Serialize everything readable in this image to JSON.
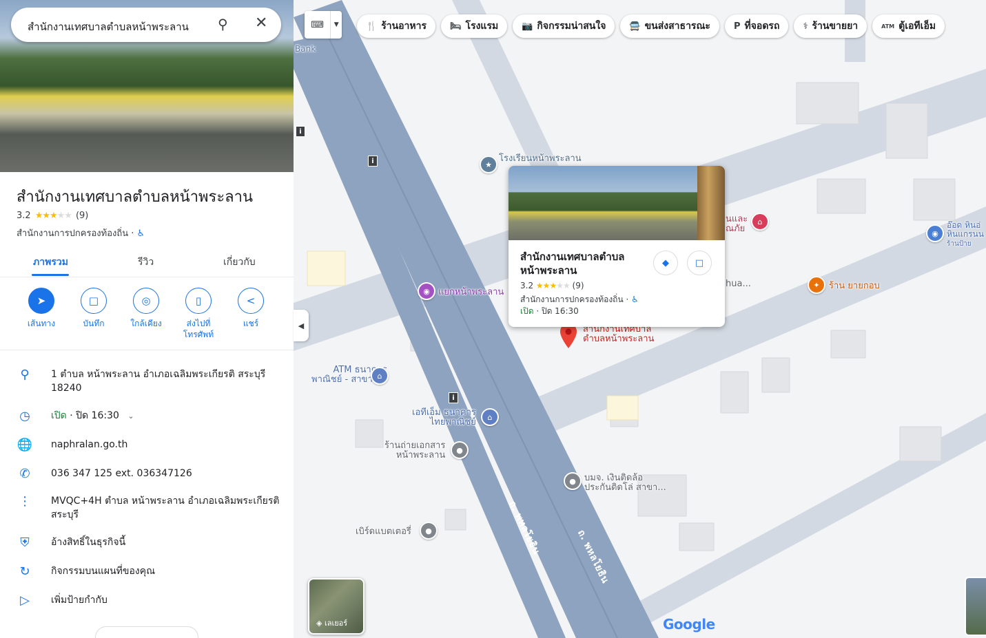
{
  "search": {
    "query": "สำนักงานเทศบาลตำบลหน้าพระลาน"
  },
  "place": {
    "name": "สำนักงานเทศบาลตำบลหน้าพระลาน",
    "rating": "3.2",
    "reviews": "(9)",
    "category": "สำนักงานการปกครองท้องถิ่น ·",
    "accessible_icon": "♿"
  },
  "tabs": [
    {
      "label": "ภาพรวม"
    },
    {
      "label": "รีวิว"
    },
    {
      "label": "เกี่ยวกับ"
    }
  ],
  "actions": [
    {
      "label": "เส้นทาง",
      "icon": "directions-icon"
    },
    {
      "label": "บันทึก",
      "icon": "bookmark-icon"
    },
    {
      "label": "ใกล้เคียง",
      "icon": "nearby-icon"
    },
    {
      "label": "ส่งไปที่",
      "label2": "โทรศัพท์",
      "icon": "send-to-phone-icon"
    },
    {
      "label": "แชร์",
      "icon": "share-icon"
    }
  ],
  "info": {
    "address": "1 ตำบล หน้าพระลาน อำเภอเฉลิมพระเกียรติ สระบุรี 18240",
    "hours_open": "เปิด",
    "hours_close": " · ปิด 16:30",
    "website": "naphralan.go.th",
    "phone": "036 347 125 ext. 036347126",
    "plus_code": "MVQC+4H ตำบล หน้าพระลาน อำเภอเฉลิมพระเกียรติ สระบุรี",
    "claim": "อ้างสิทธิ์ในธุรกิจนี้",
    "activity": "กิจกรรมบนแผนที่ของคุณ",
    "label": "เพิ่มป้ายกำกับ"
  },
  "chips": [
    {
      "label": "ร้านอาหาร",
      "icon": "🍴"
    },
    {
      "label": "โรงแรม",
      "icon": "🛏"
    },
    {
      "label": "กิจกรรมน่าสนใจ",
      "icon": "📷"
    },
    {
      "label": "ขนส่งสาธารณะ",
      "icon": "🚍"
    },
    {
      "label": "ที่จอดรถ",
      "icon": "P"
    },
    {
      "label": "ร้านขายยา",
      "icon": "⚕"
    },
    {
      "label": "ตู้เอทีเอ็ม",
      "icon": "ATM"
    }
  ],
  "card": {
    "title": "สำนักงานเทศบาลตำบลหน้าพระลาน",
    "rating": "3.2",
    "reviews": "(9)",
    "category": "สำนักงานการปกครองท้องถิ่น ·",
    "open": "เปิด",
    "close": " · ปิด 16:30"
  },
  "map_labels": {
    "bank": "Bank",
    "school": "โรงเรียนหน้าพระลาน",
    "junction": "แยกหน้าพระลาน",
    "atm1_line1": "ATM ธนาคาร",
    "atm1_line2": "พาณิชย์ - สาขาห...",
    "atm2_line1": "เอทีเอ็ม ธนาคาร",
    "atm2_line2": "ไทยพาณิชย์",
    "photocopy_line1": "ร้านถ่ายเอกสาร",
    "photocopy_line2": "หน้าพระลาน",
    "insurance_line1": "บมจ. เงินติดล้อ",
    "insurance_line2": "ประกันติดโล่ สาขา...",
    "battery": "เบิร์ดแบตเตอรี่",
    "restaurant": "ร้าน ยายกอบ",
    "pin_line1": "สำนักงานเทศบาล",
    "pin_line2": "ตำบลหน้าพระลาน",
    "edge1_line1": "นและ",
    "edge1_line2": "ณภัย",
    "edge2": "hua...",
    "right_line1": "อ๊อด หินอ่",
    "right_line2": "หินแกรนน",
    "right_line3": "ร้านป้าย",
    "road1": "ถ. พหลโยธิน",
    "road2": "ถ. พหลโยธิน",
    "layers": "เลเยอร์",
    "google": "Google"
  }
}
